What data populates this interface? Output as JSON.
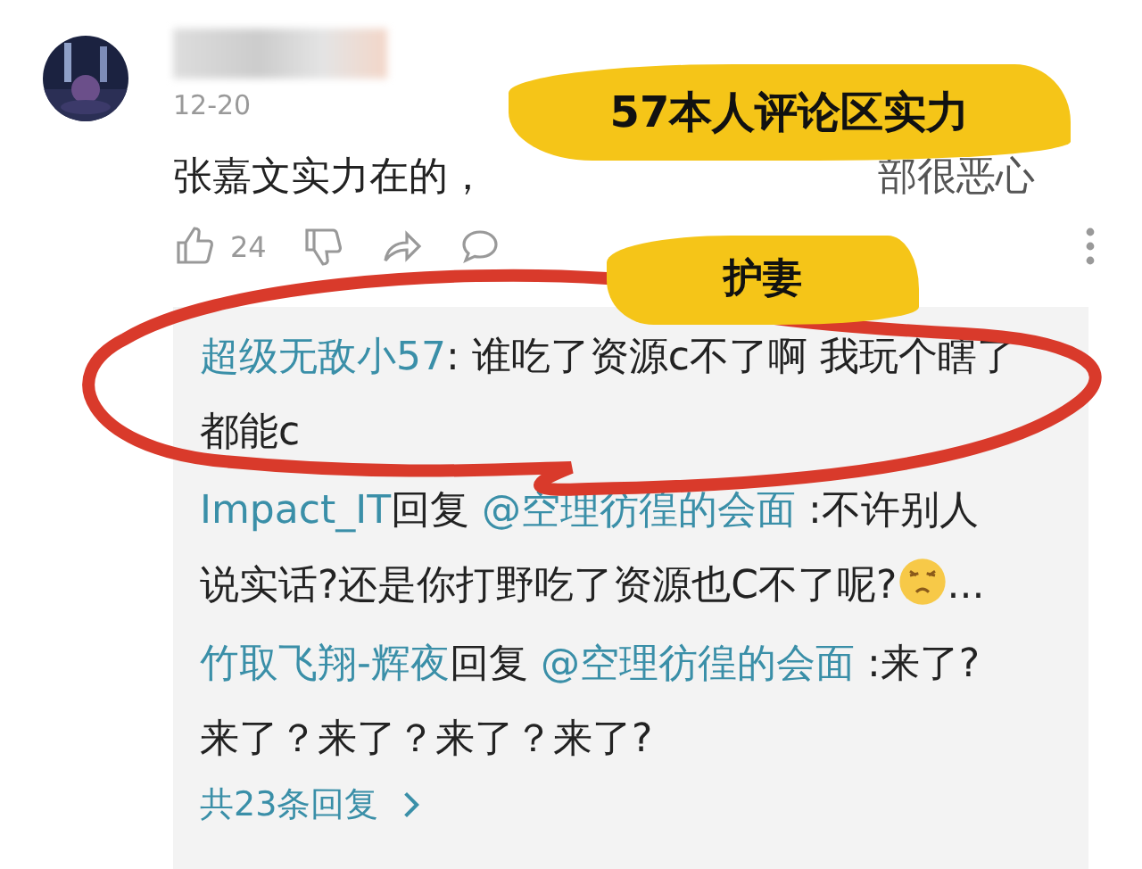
{
  "comment": {
    "date": "12-20",
    "text_start": "张嘉文实力在的，",
    "text_end": "部很恶心",
    "likes": "24"
  },
  "replies": [
    {
      "author": "超级无敌小57",
      "text": ": 谁吃了资源c不了啊 我玩个瞎了都能c"
    },
    {
      "author": "Impact_IT",
      "reply_word": "回复",
      "target": "@空理彷徨的会面",
      "text": " :不许别人说实话?还是你打野吃了资源也C不了呢?",
      "emoji": true,
      "after_emoji": "..."
    },
    {
      "author": "竹取飞翔-辉夜",
      "reply_word": "回复",
      "target": "@空理彷徨的会面",
      "text": " :来了?来了？来了？来了？来了?"
    }
  ],
  "more_replies": "共23条回复",
  "annotations": [
    {
      "text": "57本人评论区实力"
    },
    {
      "text": "护妻"
    }
  ]
}
